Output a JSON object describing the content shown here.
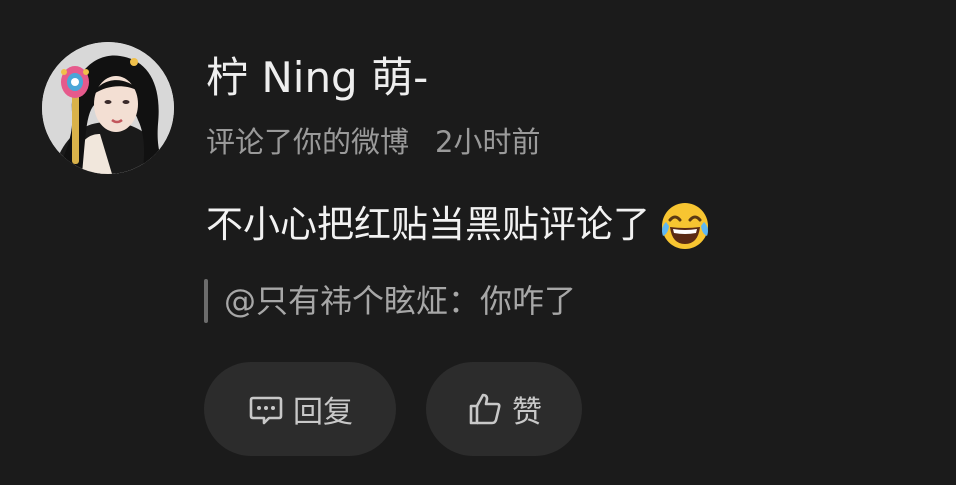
{
  "post": {
    "username": "柠 Ning 萌-",
    "action_text": "评论了你的微博",
    "time_ago": "2小时前",
    "comment_text": "不小心把红贴当黑贴评论了",
    "emoji": "laughing-crying-emoji",
    "quote_text": "@只有祎个眩炡：你咋了"
  },
  "actions": {
    "reply_label": "回复",
    "like_label": "赞",
    "reply_icon": "comment-bubble-icon",
    "like_icon": "thumbs-up-icon"
  },
  "colors": {
    "background": "#1b1b1b",
    "button_bg": "#2c2c2c",
    "primary_text": "#eeeeee",
    "secondary_text": "#9a9a9a"
  }
}
